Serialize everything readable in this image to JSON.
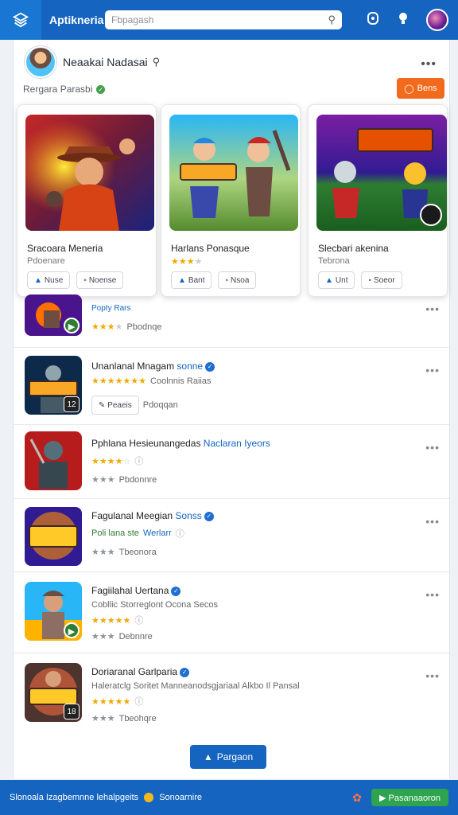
{
  "header": {
    "app_title": "Aptikneria",
    "search_placeholder": "Fbpagash",
    "accent": "#1565c0"
  },
  "profile": {
    "name": "Neaakai Nadasai",
    "sub_label": "Rergara Parasbi",
    "follow_label": "Bens",
    "follow_color": "#f26b1d"
  },
  "featured": [
    {
      "title": "Sracoara Meneria",
      "subtitle": "Pdoenare",
      "btn1": "Nuse",
      "btn2": "Noense"
    },
    {
      "title": "Harlans Ponasque",
      "subtitle": "",
      "btn1": "Bant",
      "btn2": "Nsoa"
    },
    {
      "title": "Slecbari akenina",
      "subtitle": "Tebrona",
      "btn1": "Unt",
      "btn2": "Soeor"
    }
  ],
  "list": [
    {
      "title": "Popty Rars",
      "line1": "Pbodnqe",
      "rating_count": ""
    },
    {
      "title": "Unanlanal Mnagam",
      "title_hl": "sonne",
      "line1": "Coolnnis Raiias",
      "btn1": "Peaeis",
      "btn2": "Pdoqqan"
    },
    {
      "title": "Pphlana Hesieunangedas",
      "title_hl": "Naclaran Iyeors",
      "line2": "Pbdonnre"
    },
    {
      "title": "Fagulanal Meegian",
      "title_hl": "Sonss",
      "line1": "Poli lana ste",
      "line1_green": "Werlarr",
      "line2": "Tbeonora"
    },
    {
      "title": "Fagiilahal Uertana",
      "line1": "Cobllic Storreglont Ocona Secos",
      "line2": "Debnnre"
    },
    {
      "title": "Doriaranal Garlparia",
      "line1": "Haleratclg Soritet Manneanodsgjariaal Alkbo Il Pansal",
      "line2": "Tbeohqre"
    }
  ],
  "load_more_label": "Pargaon",
  "footer": {
    "text1": "Slonoala Izagbemnne lehalpgeits",
    "text2": "Sonoarnire",
    "btn_label": "Pasanaaoron"
  }
}
